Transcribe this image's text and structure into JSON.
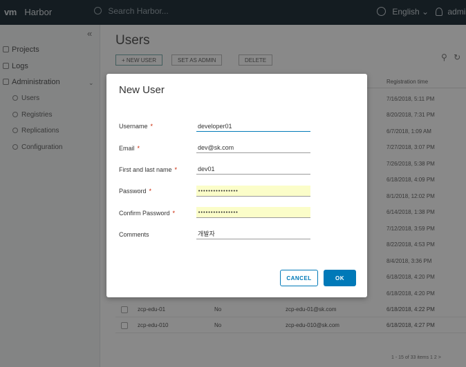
{
  "header": {
    "logo": "vm",
    "app_name": "Harbor",
    "search_placeholder": "Search Harbor...",
    "language": "English",
    "language_caret": "⌄",
    "user": "admin"
  },
  "sidebar": {
    "collapse_glyph": "«",
    "items": [
      {
        "label": "Projects"
      },
      {
        "label": "Logs"
      },
      {
        "label": "Administration"
      }
    ],
    "sub_items": [
      {
        "label": "Users"
      },
      {
        "label": "Registries"
      },
      {
        "label": "Replications"
      },
      {
        "label": "Configuration"
      }
    ]
  },
  "main": {
    "title": "Users",
    "toolbar": {
      "new_user": "+ NEW USER",
      "set_admin": "SET AS ADMIN",
      "delete": "DELETE"
    },
    "columns": {
      "registration_time": "Registration time"
    },
    "registration_times": [
      "7/16/2018, 5:11 PM",
      "8/20/2018, 7:31 PM",
      "6/7/2018, 1:09 AM",
      "7/27/2018, 3:07 PM",
      "7/26/2018, 5:38 PM",
      "6/18/2018, 4:09 PM",
      "8/1/2018, 12:02 PM",
      "6/14/2018, 1:38 PM",
      "7/12/2018, 3:59 PM",
      "8/22/2018, 4:53 PM",
      "8/4/2018, 3:36 PM",
      "6/18/2018, 4:20 PM",
      "6/18/2018, 4:20 PM"
    ],
    "rows": [
      {
        "username": "zcp-edu-01",
        "admin": "No",
        "email": "zcp-edu-01@sk.com",
        "time": "6/18/2018, 4:22 PM"
      },
      {
        "username": "zcp-edu-010",
        "admin": "No",
        "email": "zcp-edu-010@sk.com",
        "time": "6/18/2018, 4:27 PM"
      }
    ],
    "pagination": "1 - 15 of 33 items   1  2  >"
  },
  "modal": {
    "title": "New User",
    "fields": {
      "username": {
        "label": "Username",
        "value": "developer01"
      },
      "email": {
        "label": "Email",
        "value": "dev@sk.com"
      },
      "fullname": {
        "label": "First and last name",
        "value": "dev01"
      },
      "password": {
        "label": "Password",
        "value": "••••••••••••••••"
      },
      "confirm": {
        "label": "Confirm Password",
        "value": "••••••••••••••••"
      },
      "comments": {
        "label": "Comments",
        "value": "개발자"
      }
    },
    "required_mark": "*",
    "cancel_label": "CANCEL",
    "ok_label": "OK"
  },
  "colors": {
    "header_bg": "#25333d",
    "accent": "#0079b8",
    "required": "#c92100",
    "autofill": "#fbfdc9"
  }
}
